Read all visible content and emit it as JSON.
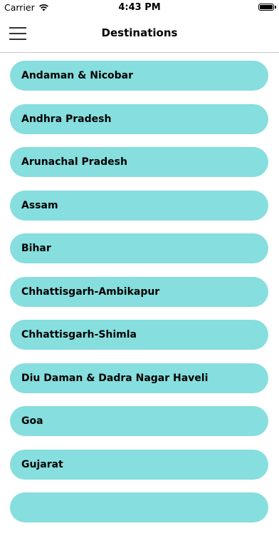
{
  "status_bar": {
    "carrier": "Carrier",
    "time": "4:43 PM"
  },
  "nav": {
    "title": "Destinations",
    "menu_icon": "hamburger-menu-icon"
  },
  "colors": {
    "item_background": "#86dede",
    "text": "#000000"
  },
  "destinations": [
    "Andaman & Nicobar",
    "Andhra Pradesh",
    "Arunachal Pradesh",
    "Assam",
    "Bihar",
    "Chhattisgarh-Ambikapur",
    "Chhattisgarh-Shimla",
    "Diu Daman & Dadra Nagar Haveli",
    "Goa",
    "Gujarat",
    ""
  ]
}
